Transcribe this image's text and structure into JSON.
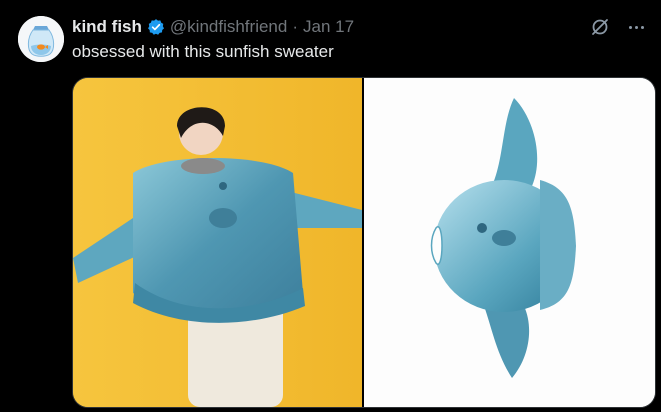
{
  "tweet": {
    "author_name": "kind fish",
    "author_handle": "@kindfishfriend",
    "separator": "·",
    "date": "Jan 17",
    "text": "obsessed with this sunfish sweater"
  },
  "icons": {
    "verified": "verified-badge-icon",
    "grok": "grok-icon",
    "more": "more-icon",
    "avatar": "goldfish-bag-icon"
  },
  "colors": {
    "background": "#000000",
    "text": "#e7e9ea",
    "secondary": "#71767b",
    "verified_blue": "#1d9bf0",
    "left_photo_bg": "#f4bf3a",
    "sweater_blue": "#5aa6bf"
  }
}
